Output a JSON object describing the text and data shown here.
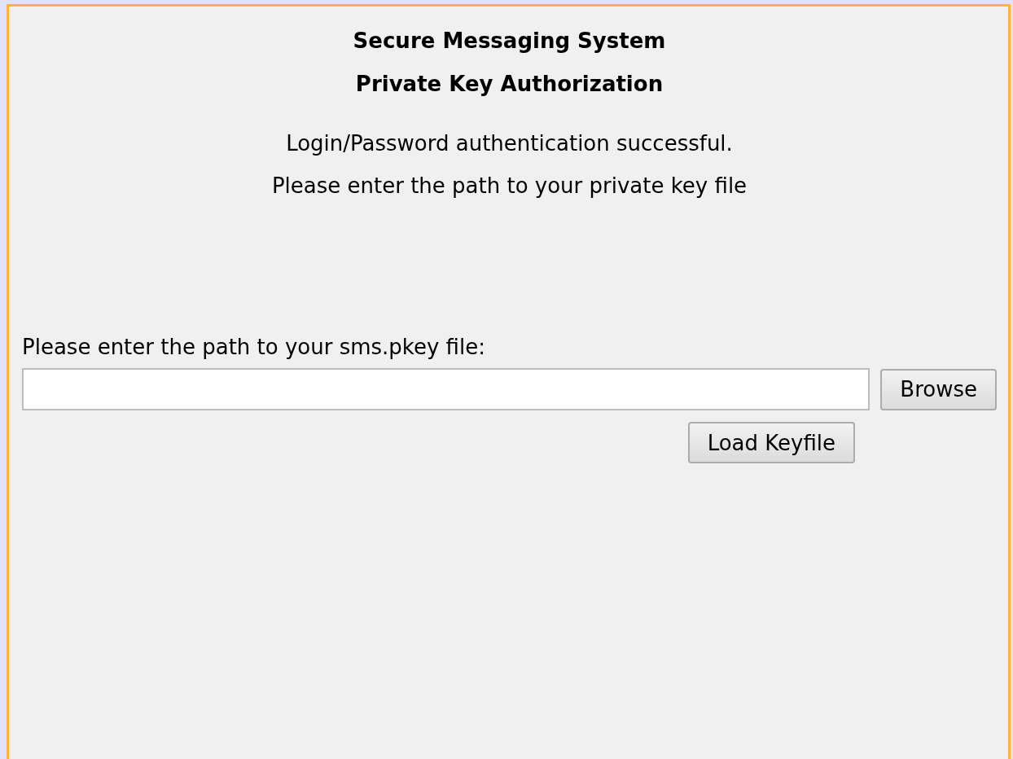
{
  "heading": [
    "Secure Messaging System",
    "Private Key Authorization"
  ],
  "messages": [
    "Login/Password authentication successful.",
    "Please enter the path to your private key file"
  ],
  "keyfile": {
    "label": "Please enter the path to your sms.pkey file:",
    "browse_button": "Browse",
    "load_button": "Load Keyfile"
  }
}
